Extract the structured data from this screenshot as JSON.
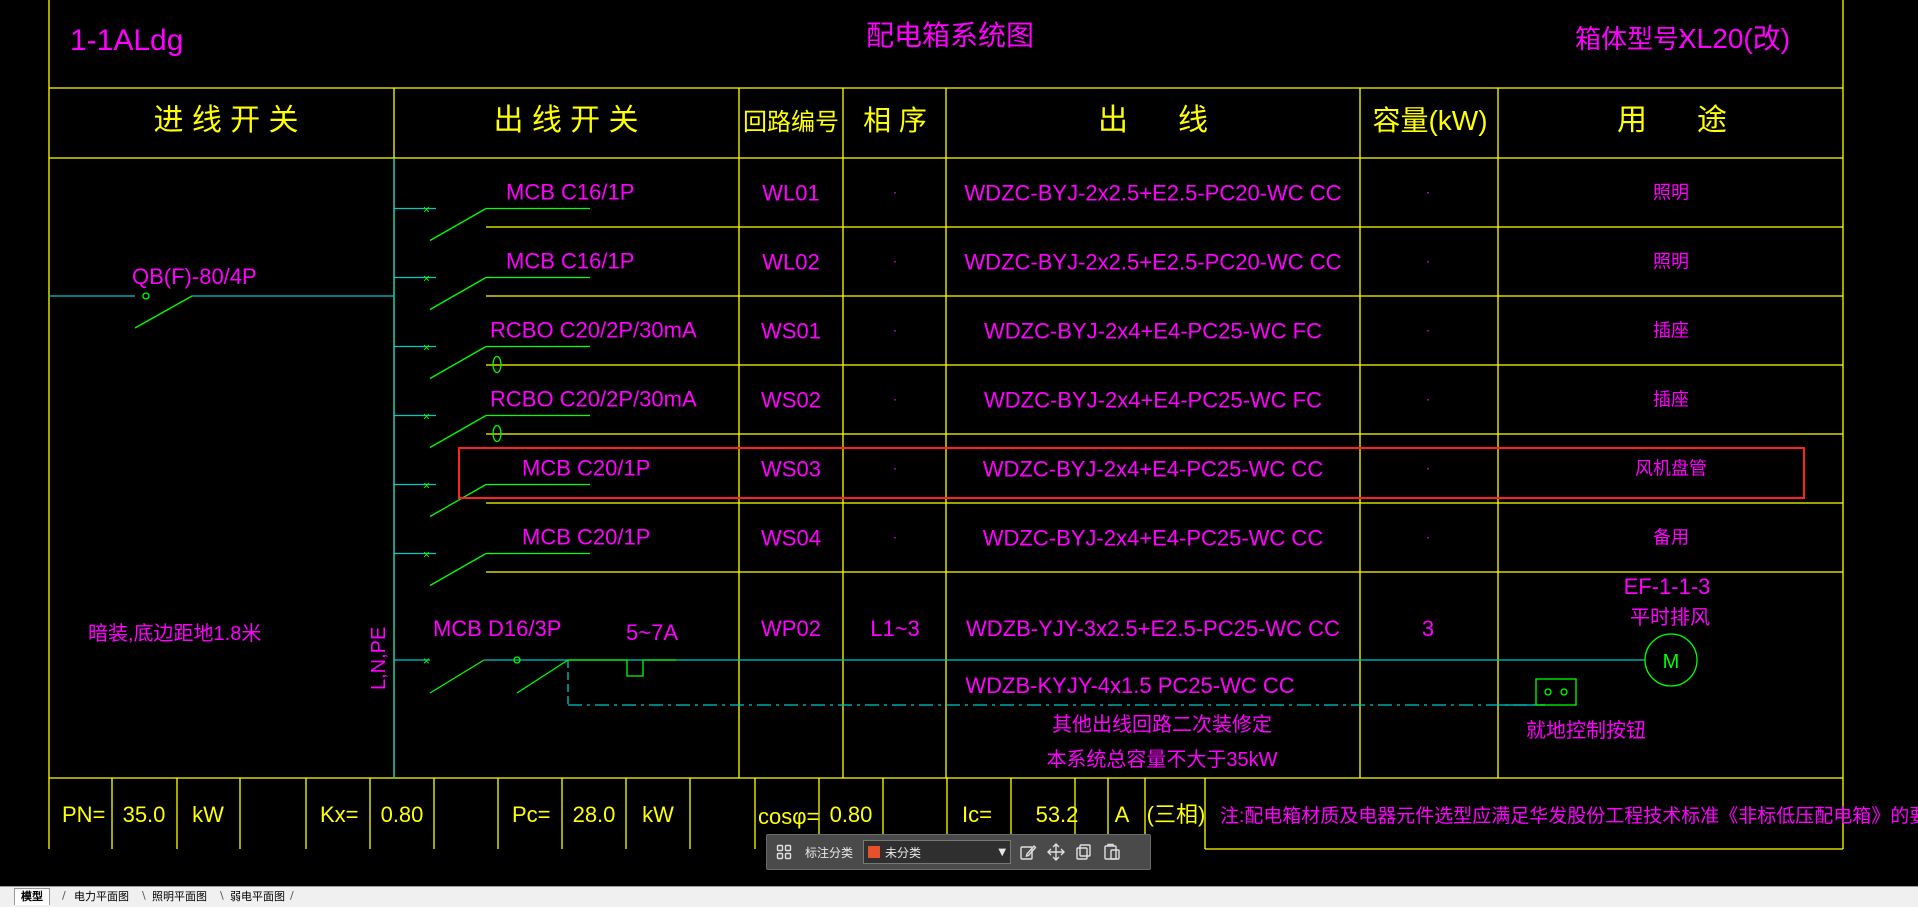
{
  "drawing": {
    "box_id": "1-1ALdg",
    "title": "配电箱系统图",
    "model_label": "箱体型号:",
    "model_value": "XL20(改)",
    "headers": {
      "incoming": "进 线 开 关",
      "outgoing": "出 线 开 关",
      "circuit_no": "回路编号",
      "phase": "相 序",
      "outlet": "出      线",
      "capacity": "容量(kW)",
      "purpose": "用      途"
    },
    "incoming_breaker": "QB(F)-80/4P",
    "install_note": "暗装,底边距地1.8米",
    "bus_label": "L,N,PE",
    "circuits": [
      {
        "breaker": "MCB C16/1P",
        "no": "WL01",
        "phase": "·",
        "cable": "WDZC-BYJ-2x2.5+E2.5-PC20-WC CC",
        "capacity": "·",
        "purpose": "照明"
      },
      {
        "breaker": "MCB C16/1P",
        "no": "WL02",
        "phase": "·",
        "cable": "WDZC-BYJ-2x2.5+E2.5-PC20-WC CC",
        "capacity": "·",
        "purpose": "照明"
      },
      {
        "breaker": "RCBO C20/2P/30mA",
        "no": "WS01",
        "phase": "·",
        "cable": "WDZC-BYJ-2x4+E4-PC25-WC FC",
        "capacity": "·",
        "purpose": "插座"
      },
      {
        "breaker": "RCBO C20/2P/30mA",
        "no": "WS02",
        "phase": "·",
        "cable": "WDZC-BYJ-2x4+E4-PC25-WC FC",
        "capacity": "·",
        "purpose": "插座"
      },
      {
        "breaker": "MCB C20/1P",
        "no": "WS03",
        "phase": "·",
        "cable": "WDZC-BYJ-2x4+E4-PC25-WC CC",
        "capacity": "·",
        "purpose": "风机盘管"
      },
      {
        "breaker": "MCB C20/1P",
        "no": "WS04",
        "phase": "·",
        "cable": "WDZC-BYJ-2x4+E4-PC25-WC CC",
        "capacity": "·",
        "purpose": "备用"
      }
    ],
    "motor_circuit": {
      "breaker": "MCB D16/3P",
      "overload": "5~7A",
      "no": "WP02",
      "phase": "L1~3",
      "cable": "WDZB-YJY-3x2.5+E2.5-PC25-WC CC",
      "capacity": "3",
      "equipment_id": "EF-1-1-3",
      "equipment_name": "平时排风",
      "motor_symbol": "M",
      "control_cable": "WDZB-KYJY-4x1.5 PC25-WC CC",
      "control_button": "就地控制按钮"
    },
    "notes": [
      "其他出线回路二次装修定",
      "本系统总容量不大于35kW"
    ],
    "summary": {
      "pn_label": "PN=",
      "pn_value": "35.0",
      "pn_unit": "kW",
      "kx_label": "Kx=",
      "kx_value": "0.80",
      "pc_label": "Pc=",
      "pc_value": "28.0",
      "pc_unit": "kW",
      "cos_label": "cosφ=",
      "cos_value": "0.80",
      "ic_label": "Ic=",
      "ic_value": "53.2",
      "ic_unit": "A",
      "ic_phase": "(三相)",
      "remark": "注:配电箱材质及电器元件选型应满足华发股份工程技术标准《非标低压配电箱》的要求"
    }
  },
  "toolbar": {
    "label": "标注分类",
    "select_value": "未分类",
    "swatch_color": "#e8502a"
  },
  "tabs": [
    "模型",
    "电力平面图",
    "照明平面图",
    "弱电平面图"
  ],
  "colors": {
    "yellow": "#ffff00",
    "magenta": "#ff00ff",
    "green": "#00ff00",
    "cyan": "#00c8c8",
    "red": "#ff2020"
  }
}
